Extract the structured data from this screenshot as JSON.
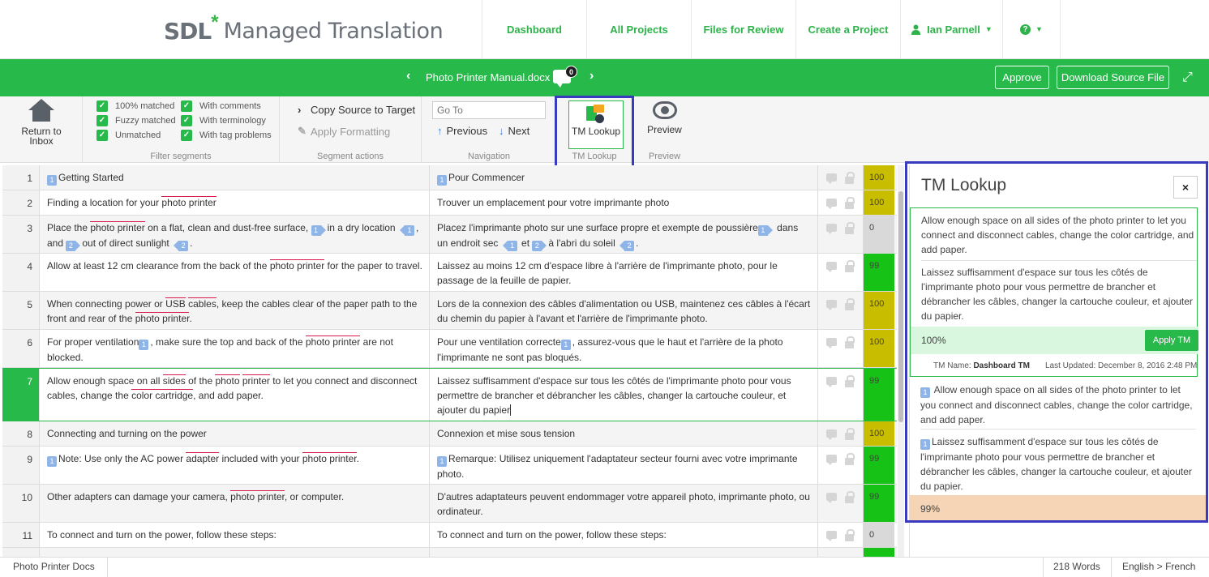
{
  "brand": {
    "sdl": "SDL",
    "star": "*",
    "product": "Managed Translation"
  },
  "nav": {
    "items": [
      "Dashboard",
      "All Projects",
      "Files for Review",
      "Create a Project"
    ],
    "user": "Ian Parnell",
    "help": "?"
  },
  "file_bar": {
    "file_name": "Photo Printer Manual.docx",
    "comment_count": "0",
    "approve": "Approve",
    "download": "Download Source File"
  },
  "toolbar": {
    "return": {
      "line1": "Return to",
      "line2": "Inbox"
    },
    "filters": {
      "items": [
        "100% matched",
        "With comments",
        "Fuzzy matched",
        "With terminology",
        "Unmatched",
        "With tag problems"
      ],
      "caption": "Filter segments"
    },
    "actions": {
      "copy": "Copy Source to Target",
      "apply": "Apply Formatting",
      "caption": "Segment actions"
    },
    "navigation": {
      "goto_placeholder": "Go To",
      "previous": "Previous",
      "next": "Next",
      "caption": "Navigation"
    },
    "tm": {
      "label": "TM Lookup",
      "caption": "TM Lookup"
    },
    "preview": {
      "label": "Preview",
      "caption": "Preview"
    }
  },
  "segments": [
    {
      "num": "1",
      "score": "100"
    },
    {
      "num": "2",
      "src": "Finding a location for your photo printer",
      "tgt": "Trouver un emplacement pour votre imprimante photo",
      "score": "100"
    },
    {
      "num": "3",
      "score": "0"
    },
    {
      "num": "4",
      "tgt": "Laissez au moins 12 cm d'espace libre à l'arrière de l'imprimante photo, pour le passage de la feuille de papier.",
      "score": "99"
    },
    {
      "num": "5",
      "tgt": "Lors de la connexion des câbles d'alimentation ou USB, maintenez ces câbles à l'écart du chemin du papier à l'avant et l'arrière de l'imprimante photo.",
      "score": "100"
    },
    {
      "num": "6",
      "score": "100"
    },
    {
      "num": "7",
      "tgt": "Laissez suffisamment d'espace sur tous les côtés de l'imprimante photo pour vous permettre de brancher et débrancher les câbles, changer la cartouche couleur, et ajouter du papier",
      "score": "99"
    },
    {
      "num": "8",
      "src": "Connecting and turning on the power",
      "tgt": "Connexion et mise sous tension",
      "score": "100"
    },
    {
      "num": "9",
      "score": "99"
    },
    {
      "num": "10",
      "tgt": "D'autres adaptateurs peuvent endommager votre appareil photo, imprimante photo, ou ordinateur.",
      "score": "99"
    },
    {
      "num": "11",
      "src": "To connect and turn on the power, follow these steps:",
      "tgt": "To connect and turn on the power, follow these steps:",
      "score": "0"
    }
  ],
  "tm_panel": {
    "title": "TM Lookup",
    "close": "×",
    "match1": {
      "source": "Allow enough space on all sides of the photo printer to let you connect and disconnect cables, change the color cartridge, and add paper.",
      "target": "Laissez suffisamment d'espace sur tous les côtés de l'imprimante photo pour vous permettre de brancher et débrancher les câbles, changer la cartouche couleur, et ajouter du papier.",
      "percent": "100%",
      "apply": "Apply TM",
      "tm_name_label": "TM Name:",
      "tm_name": "Dashboard TM",
      "updated": "Last Updated: December 8, 2016 2:48 PM"
    },
    "match2": {
      "source": "Allow enough space on all sides of the photo printer to let you connect and disconnect cables, change the color cartridge, and add paper.",
      "target": "Laissez suffisamment d'espace sur tous les côtés de l'imprimante photo pour vous permettre de brancher et débrancher les câbles, changer la cartouche couleur, et ajouter du papier.",
      "percent": "99%"
    }
  },
  "status": {
    "project": "Photo Printer Docs",
    "words": "218 Words",
    "lang_from": "English",
    "lang_sep": ">",
    "lang_to": "French"
  },
  "colors": {
    "accent": "#27b94a",
    "highlight": "#3a3ac0",
    "exact": "#c9bd00",
    "fuzzy": "#17c217",
    "peach": "#f5d5b5"
  }
}
